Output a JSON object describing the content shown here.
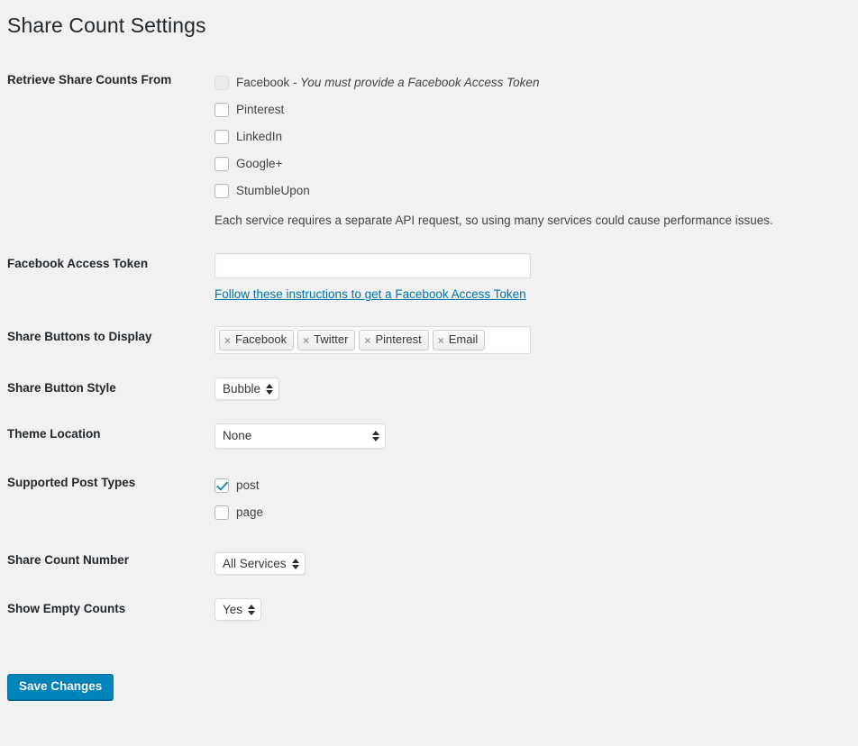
{
  "page": {
    "title": "Share Count Settings",
    "background_color": "#f1f1f1",
    "accent_color": "#0085ba",
    "link_color": "#0073aa",
    "checkmark_color": "#1e8cbe"
  },
  "rows": {
    "retrieve_from": {
      "label": "Retrieve Share Counts From",
      "options": [
        {
          "label": "Facebook",
          "note": " - You must provide a Facebook Access Token",
          "checked": false,
          "disabled": true
        },
        {
          "label": "Pinterest",
          "note": "",
          "checked": false,
          "disabled": false
        },
        {
          "label": "LinkedIn",
          "note": "",
          "checked": false,
          "disabled": false
        },
        {
          "label": "Google+",
          "note": "",
          "checked": false,
          "disabled": false
        },
        {
          "label": "StumbleUpon",
          "note": "",
          "checked": false,
          "disabled": false
        }
      ],
      "description": "Each service requires a separate API request, so using many services could cause performance issues."
    },
    "facebook_token": {
      "label": "Facebook Access Token",
      "value": "",
      "placeholder": "",
      "link_text": "Follow these instructions to get a Facebook Access Token"
    },
    "share_buttons": {
      "label": "Share Buttons to Display",
      "tokens": [
        {
          "remove_glyph": "×",
          "label": "Facebook"
        },
        {
          "remove_glyph": "×",
          "label": "Twitter"
        },
        {
          "remove_glyph": "×",
          "label": "Pinterest"
        },
        {
          "remove_glyph": "×",
          "label": "Email"
        }
      ]
    },
    "button_style": {
      "label": "Share Button Style",
      "value": "Bubble"
    },
    "theme_location": {
      "label": "Theme Location",
      "value": "None"
    },
    "post_types": {
      "label": "Supported Post Types",
      "options": [
        {
          "label": "post",
          "checked": true,
          "disabled": false
        },
        {
          "label": "page",
          "checked": false,
          "disabled": false
        }
      ]
    },
    "count_number": {
      "label": "Share Count Number",
      "value": "All Services"
    },
    "empty_counts": {
      "label": "Show Empty Counts",
      "value": "Yes"
    }
  },
  "submit": {
    "label": "Save Changes"
  }
}
